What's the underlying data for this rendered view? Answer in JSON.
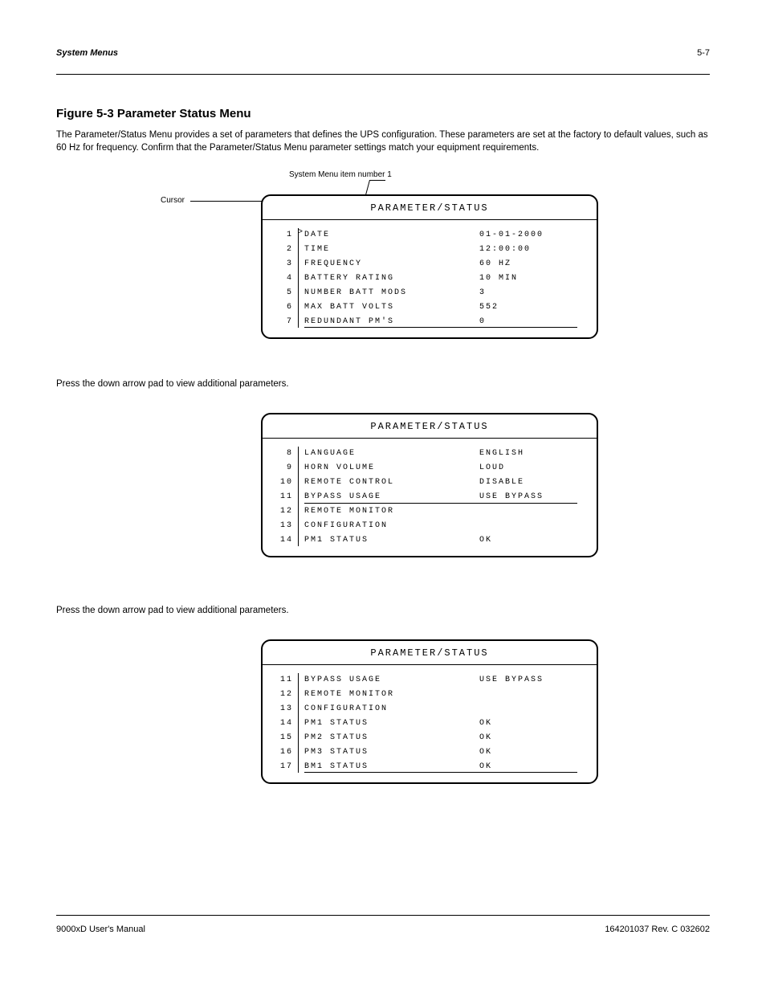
{
  "header": {
    "left": "System Menus",
    "right": "5-7"
  },
  "section_title": "Figure 5-3 Parameter Status Menu",
  "intro": "The Parameter/Status Menu provides a set of parameters that defines the UPS configuration. These parameters are set at the factory to default values, such as 60 Hz for frequency. Confirm that the Parameter/Status Menu parameter settings match your equipment requirements.",
  "callouts": {
    "cursor": "Cursor",
    "item": "System Menu item number 1"
  },
  "screen1": {
    "title": "PARAMETER/STATUS",
    "cursor": ">",
    "items": [
      {
        "num": "1",
        "label": "DATE",
        "value": "01-01-2000"
      },
      {
        "num": "2",
        "label": "TIME",
        "value": "12:00:00"
      },
      {
        "num": "3",
        "label": "FREQUENCY",
        "value": "60 HZ"
      },
      {
        "num": "4",
        "label": "BATTERY RATING",
        "value": "10 MIN"
      },
      {
        "num": "5",
        "label": "NUMBER BATT MODS",
        "value": "3"
      },
      {
        "num": "6",
        "label": "MAX BATT VOLTS",
        "value": "552"
      },
      {
        "num": "7",
        "label": "REDUNDANT PM'S",
        "value": "0"
      }
    ]
  },
  "mid1": "Press the down arrow pad to view additional parameters.",
  "screen2": {
    "title": "PARAMETER/STATUS",
    "items": [
      {
        "num": "8",
        "label": "LANGUAGE",
        "value": "ENGLISH"
      },
      {
        "num": "9",
        "label": "HORN VOLUME",
        "value": "LOUD"
      },
      {
        "num": "10",
        "label": "REMOTE CONTROL",
        "value": "DISABLE"
      },
      {
        "num": "11",
        "label": "BYPASS USAGE",
        "value": "USE BYPASS"
      },
      {
        "num": "12",
        "label": "REMOTE MONITOR",
        "value": ""
      },
      {
        "num": "13",
        "label": "CONFIGURATION",
        "value": ""
      },
      {
        "num": "14",
        "label": "PM1 STATUS",
        "value": "OK"
      }
    ]
  },
  "mid2": "Press the down arrow pad to view additional parameters.",
  "screen3": {
    "title": "PARAMETER/STATUS",
    "items": [
      {
        "num": "11",
        "label": "BYPASS USAGE",
        "value": "USE BYPASS"
      },
      {
        "num": "12",
        "label": "REMOTE MONITOR",
        "value": ""
      },
      {
        "num": "13",
        "label": "CONFIGURATION",
        "value": ""
      },
      {
        "num": "14",
        "label": "PM1 STATUS",
        "value": "OK"
      },
      {
        "num": "15",
        "label": "PM2 STATUS",
        "value": "OK"
      },
      {
        "num": "16",
        "label": "PM3 STATUS",
        "value": "OK"
      },
      {
        "num": "17",
        "label": "BM1 STATUS",
        "value": "OK"
      }
    ]
  },
  "footer": {
    "left": "9000xD User's Manual",
    "right": "164201037   Rev. C   032602"
  }
}
